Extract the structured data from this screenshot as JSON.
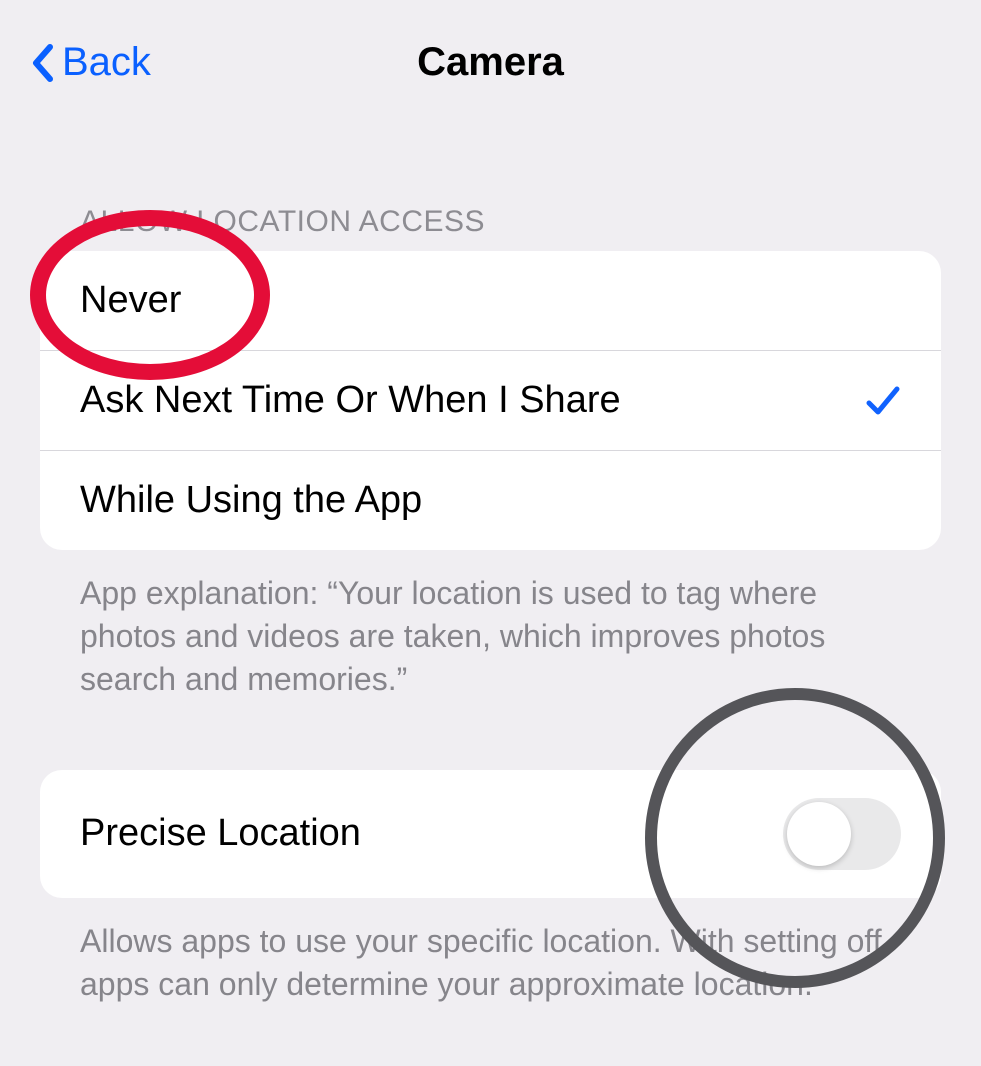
{
  "nav": {
    "back_label": "Back",
    "title": "Camera"
  },
  "location_access": {
    "header": "ALLOW LOCATION ACCESS",
    "options": [
      {
        "label": "Never",
        "selected": false
      },
      {
        "label": "Ask Next Time Or When I Share",
        "selected": true
      },
      {
        "label": "While Using the App",
        "selected": false
      }
    ],
    "explanation": "App explanation: “Your location is used to tag where photos and videos are taken, which improves photos search and memories.”"
  },
  "precise_location": {
    "label": "Precise Location",
    "enabled": false,
    "explanation": "Allows apps to use your specific location. With setting off, apps can only determine your approximate location."
  },
  "annotations": {
    "red_ellipse_target": "option-never",
    "grey_circle_target": "precise-location-toggle"
  }
}
